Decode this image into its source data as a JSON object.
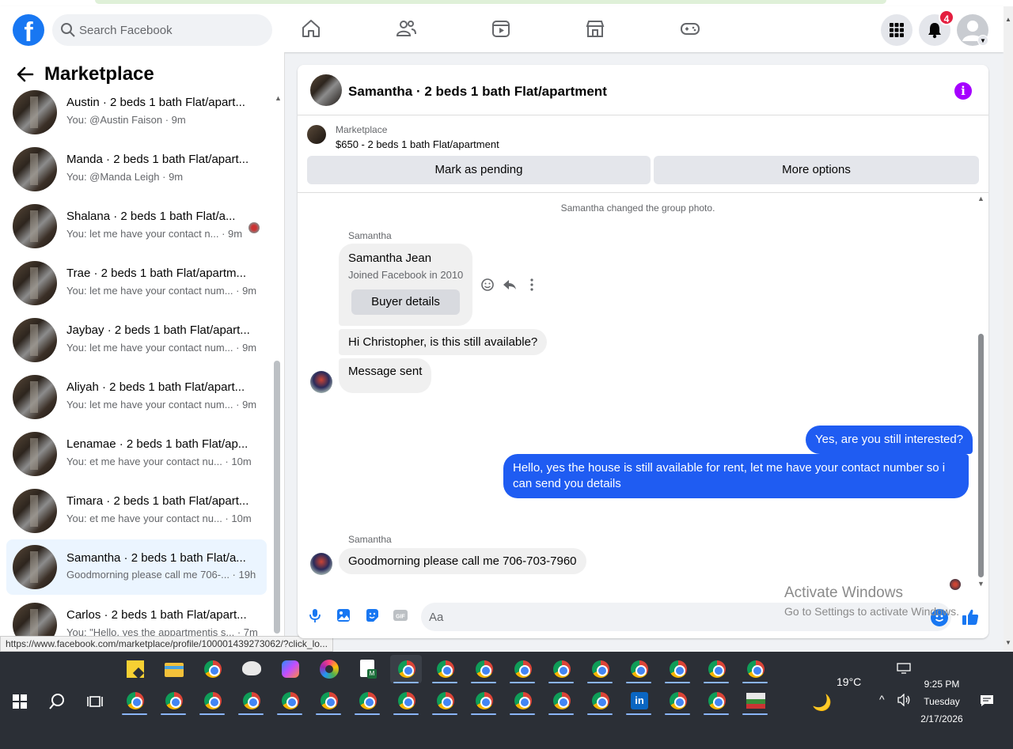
{
  "header": {
    "logo_letter": "f",
    "search_placeholder": "Search Facebook",
    "nav_icons": [
      "home-icon",
      "friends-icon",
      "video-icon",
      "marketplace-icon",
      "gaming-icon"
    ],
    "notification_count": "4"
  },
  "sidebar": {
    "title": "Marketplace",
    "conversations": [
      {
        "name": "Austin · 2 beds 1 bath Flat/apart...",
        "snippet": "You: @Austin Faison · 9m"
      },
      {
        "name": "Manda · 2 beds 1 bath Flat/apart...",
        "snippet": "You: @Manda Leigh · 9m"
      },
      {
        "name": "Shalana · 2 beds 1 bath Flat/a...",
        "snippet": "You: let me have your contact n... · 9m"
      },
      {
        "name": "Trae · 2 beds 1 bath Flat/apartm...",
        "snippet": "You: let me have your contact num... · 9m"
      },
      {
        "name": "Jaybay · 2 beds 1 bath Flat/apart...",
        "snippet": "You: let me have your contact num... · 9m"
      },
      {
        "name": "Aliyah · 2 beds 1 bath Flat/apart...",
        "snippet": "You: let me have your contact num... · 9m"
      },
      {
        "name": "Lenamae · 2 beds 1 bath Flat/ap...",
        "snippet": "You: et me have your contact nu... · 10m"
      },
      {
        "name": "Timara · 2 beds 1 bath Flat/apart...",
        "snippet": "You: et me have your contact nu... · 10m"
      },
      {
        "name": "Samantha · 2 beds 1 bath Flat/a...",
        "snippet": "Goodmorning please call me 706-... · 19h"
      },
      {
        "name": "Carlos · 2 beds 1 bath Flat/apart...",
        "snippet": "You: \"Hello, yes the appartmentis s... · 7m"
      }
    ]
  },
  "status_url": "https://www.facebook.com/marketplace/profile/100001439273062/?click_lo...",
  "chat": {
    "title": "Samantha · 2 beds 1 bath Flat/apartment",
    "listing_label": "Marketplace",
    "listing_title": "$650 - 2 beds 1 bath Flat/apartment",
    "btn_pending": "Mark as pending",
    "btn_more": "More options",
    "system_msg": "Samantha changed the group photo.",
    "sender_1": "Samantha",
    "card_name": "Samantha Jean",
    "card_sub": "Joined Facebook in 2010",
    "card_button": "Buyer details",
    "msg_1": "Hi Christopher, is this still available?",
    "msg_2": "Message sent",
    "msg_3": "Yes, are you still interested?",
    "msg_4": "Hello, yes the house is still available for rent, let me have your contact number so i can send you details",
    "sender_2": "Samantha",
    "msg_5": "Goodmorning please call me 706-703-7960",
    "composer_placeholder": "Aa"
  },
  "watermark": {
    "line1": "Activate Windows",
    "line2": "Go to Settings to activate Windows."
  },
  "taskbar": {
    "temperature": "19°C",
    "time": "9:25 PM",
    "day": "Tuesday",
    "date": "2/17/2026"
  },
  "colors": {
    "facebook_blue": "#1877f2",
    "my_bubble": "#1f5cf2",
    "info_purple": "#a500ff",
    "badge_red": "#e41e3f"
  }
}
